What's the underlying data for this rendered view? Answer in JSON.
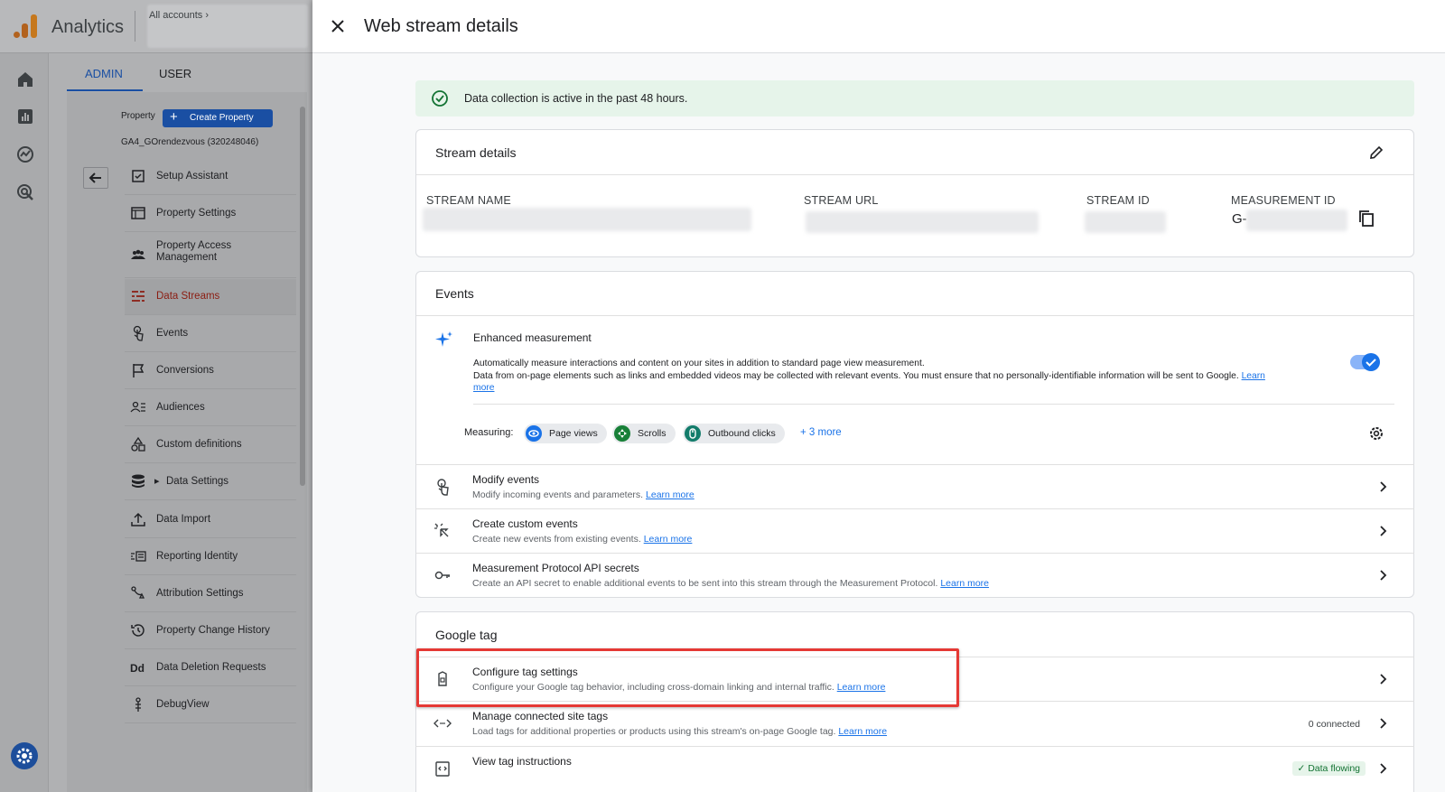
{
  "app": {
    "name": "Analytics",
    "all_accounts": "All accounts"
  },
  "left": {
    "tabs": [
      "ADMIN",
      "USER"
    ],
    "property_label": "Property",
    "create_property": "Create Property",
    "property_name": "GA4_GOrendezvous (320248046)",
    "nav": [
      {
        "label": "Setup Assistant",
        "icon": "checkbox-icon"
      },
      {
        "label": "Property Settings",
        "icon": "window-icon"
      },
      {
        "label": "Property Access Management",
        "icon": "people-icon"
      },
      {
        "label": "Data Streams",
        "icon": "streams-icon",
        "active": true
      },
      {
        "label": "Events",
        "icon": "touch-icon"
      },
      {
        "label": "Conversions",
        "icon": "flag-icon"
      },
      {
        "label": "Audiences",
        "icon": "audience-icon"
      },
      {
        "label": "Custom definitions",
        "icon": "shapes-icon"
      },
      {
        "label": "Data Settings",
        "icon": "database-icon"
      },
      {
        "label": "Data Import",
        "icon": "upload-icon"
      },
      {
        "label": "Reporting Identity",
        "icon": "identity-icon"
      },
      {
        "label": "Attribution Settings",
        "icon": "attribution-icon"
      },
      {
        "label": "Property Change History",
        "icon": "history-icon"
      },
      {
        "label": "Data Deletion Requests",
        "icon": "dd-icon"
      },
      {
        "label": "DebugView",
        "icon": "debug-icon"
      }
    ]
  },
  "detail": {
    "title": "Web stream details",
    "banner": "Data collection is active in the past 48 hours.",
    "stream_details": {
      "heading": "Stream details",
      "columns": [
        "STREAM NAME",
        "STREAM URL",
        "STREAM ID",
        "MEASUREMENT ID"
      ],
      "measurement_id_prefix": "G-"
    },
    "events": {
      "heading": "Events",
      "enhanced_title": "Enhanced measurement",
      "enhanced_desc1": "Automatically measure interactions and content on your sites in addition to standard page view measurement.",
      "enhanced_desc2": "Data from on-page elements such as links and embedded videos may be collected with relevant events. You must ensure that no personally-identifiable information will be sent to Google.",
      "learn_more": "Learn more",
      "learn_more_a": "Learn",
      "learn_more_b": "more",
      "measuring_label": "Measuring:",
      "chips": [
        "Page views",
        "Scrolls",
        "Outbound clicks"
      ],
      "more": "+ 3 more",
      "toggle_on": true,
      "rows": [
        {
          "title": "Modify events",
          "desc": "Modify incoming events and parameters."
        },
        {
          "title": "Create custom events",
          "desc": "Create new events from existing events."
        },
        {
          "title": "Measurement Protocol API secrets",
          "desc": "Create an API secret to enable additional events to be sent into this stream through the Measurement Protocol."
        }
      ]
    },
    "google_tag": {
      "heading": "Google tag",
      "rows": [
        {
          "title": "Configure tag settings",
          "desc": "Configure your Google tag behavior, including cross-domain linking and internal traffic."
        },
        {
          "title": "Manage connected site tags",
          "desc": "Load tags for additional properties or products using this stream's on-page Google tag.",
          "badge": "0 connected"
        },
        {
          "title": "View tag instructions",
          "badge": "Data flowing"
        }
      ]
    }
  },
  "colors": {
    "accent": "#1a73e8",
    "banner_bg": "#e6f4ea",
    "highlight": "#e53935",
    "active_nav": "#8b1d12"
  }
}
